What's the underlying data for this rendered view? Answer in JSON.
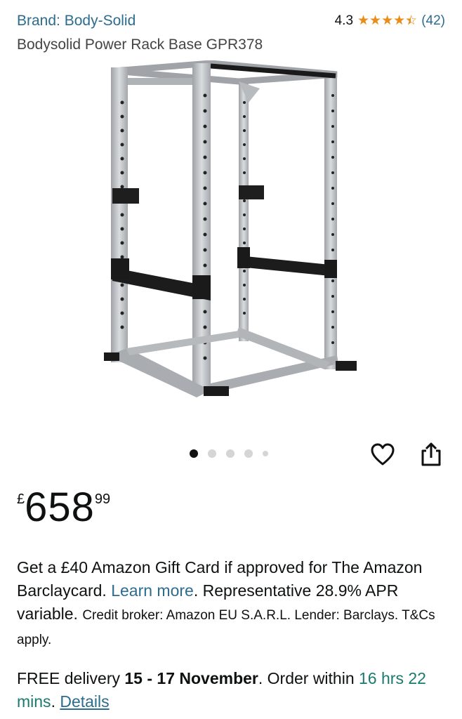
{
  "header": {
    "brand_link": "Brand: Body-Solid",
    "rating_value": "4.3",
    "stars_value": 4.3,
    "stars_max": 5,
    "review_count": "(42)",
    "product_title": "Bodysolid Power Rack Base GPR378"
  },
  "gallery": {
    "image_subject": "power rack product photo",
    "dot_count": 5,
    "active_index": 0
  },
  "actions": {
    "wishlist_icon": "heart-icon",
    "share_icon": "share-icon"
  },
  "price": {
    "currency": "£",
    "whole": "658",
    "fraction": "99"
  },
  "credit": {
    "line1": "Get a £40 Amazon Gift Card if approved for The Amazon Barclaycard.",
    "learn_more": "Learn more",
    "period": ".",
    "line2": "Representative 28.9% APR variable.",
    "line2_small": "Credit broker: Amazon EU S.A.R.L. Lender: Barclays. T&Cs apply."
  },
  "delivery": {
    "prefix": "FREE delivery",
    "dates": "15 - 17 November",
    "order_within": ". Order within",
    "countdown": "16 hrs 22 mins",
    "dot": ".",
    "details_link": "Details"
  },
  "colors": {
    "link": "#2b6c8f",
    "star": "#e98d18",
    "countdown": "#1b7a6e"
  }
}
